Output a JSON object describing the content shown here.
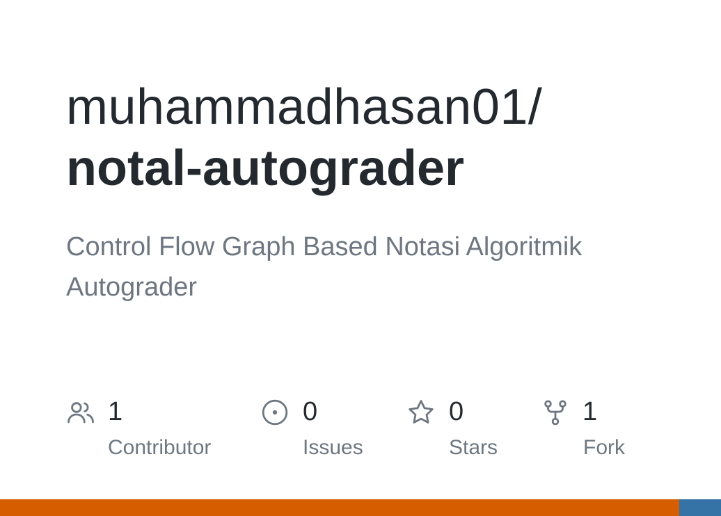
{
  "repo": {
    "owner": "muhammadhasan01/",
    "name": "notal-autograder",
    "description": "Control Flow Graph Based Notasi Algoritmik Autograder"
  },
  "stats": [
    {
      "icon": "people-icon",
      "count": "1",
      "label": "Contributor"
    },
    {
      "icon": "issue-icon",
      "count": "0",
      "label": "Issues"
    },
    {
      "icon": "star-icon",
      "count": "0",
      "label": "Stars"
    },
    {
      "icon": "fork-icon",
      "count": "1",
      "label": "Fork"
    }
  ],
  "language_bar": {
    "segments": [
      {
        "color": "#D65E00",
        "fraction": 0.942
      },
      {
        "color": "#3572A5",
        "fraction": 0.058
      }
    ]
  },
  "colors": {
    "title": "#24292f",
    "muted": "#6e7781"
  }
}
